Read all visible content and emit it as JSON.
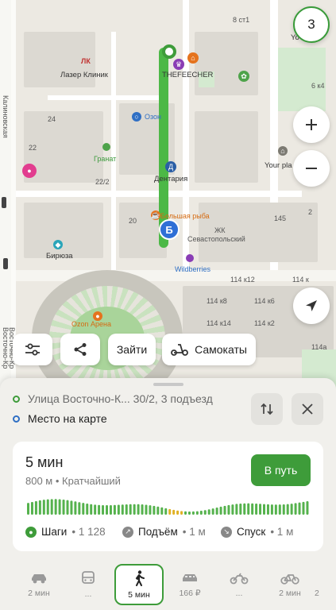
{
  "map": {
    "speed_badge": "3",
    "labels": {
      "laser_clinic": "Лазер Клиник",
      "thefeecher": "THEFEECHER",
      "ozon": "Озон",
      "granat": "Гранат",
      "dentaria": "Дентария",
      "big_fish": "Большая рыба",
      "zhk": "ЖК",
      "sevastopolsky": "Севастопольский",
      "wildberries": "Wildberries",
      "biryuza": "Бирюза",
      "ozon_arena": "Ozon Арена",
      "your_place": "Your pla",
      "vostochno_kr": "Восточно-Кр",
      "vostochno_kr2": "Восточно-Кр",
      "kalinovskaya": "Калиновская",
      "b24": "24",
      "b22": "22",
      "b22_2": "22/2",
      "b20": "20",
      "b145": "145",
      "b2": "2",
      "b6k4": "6 к4",
      "b8st1": "8 ст1",
      "b114k12": "114 к12",
      "b114k8": "114 к8",
      "b114k6": "114 к6",
      "b114k2": "114 к2",
      "b114a": "114а",
      "b114k14": "114 к14",
      "b114k": "114 к",
      "b114_2": "114",
      "lk": "ЛК",
      "yo": "Yo"
    },
    "end_marker": "Б",
    "actions": {
      "enter": "Зайти",
      "scooters": "Самокаты"
    }
  },
  "route": {
    "from": "Улица Восточно-К... 30/2, 3 подъезд",
    "to": "Место на карте",
    "from_color": "#3e9c3a",
    "to_color": "#2f6fc4"
  },
  "summary": {
    "time": "5 мин",
    "details": "800 м • Кратчайший",
    "go_label": "В путь",
    "steps_label": "Шаги",
    "steps_value": "• 1 128",
    "up_label": "Подъём",
    "up_value": "• 1 м",
    "down_label": "Спуск",
    "down_value": "• 1 м",
    "accent": "#3e9c3a"
  },
  "tabs": [
    {
      "icon": "car-icon",
      "label": "2 мин"
    },
    {
      "icon": "bus-icon",
      "label": "..."
    },
    {
      "icon": "walk-icon",
      "label": "5 мин",
      "active": true
    },
    {
      "icon": "taxi-icon",
      "label": "166 ₽"
    },
    {
      "icon": "scooter-icon",
      "label": "..."
    },
    {
      "icon": "bicycle-icon",
      "label": "2 мин"
    },
    {
      "icon": "more-icon",
      "label": "2"
    }
  ]
}
